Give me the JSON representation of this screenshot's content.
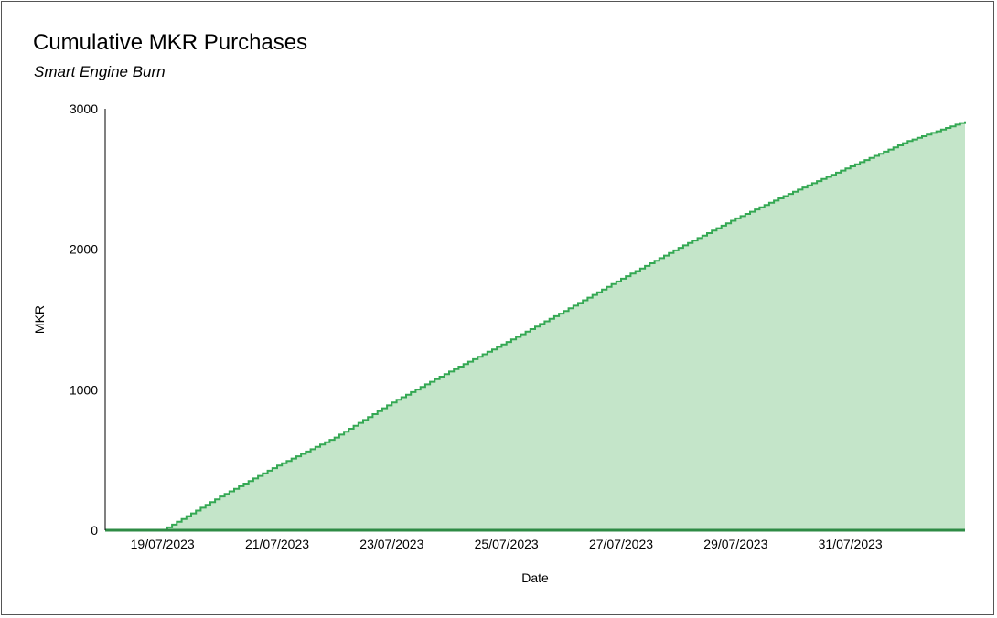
{
  "chart_data": {
    "type": "area",
    "title": "Cumulative MKR Purchases",
    "subtitle": "Smart Engine Burn",
    "xlabel": "Date",
    "ylabel": "MKR",
    "ylim": [
      0,
      3000
    ],
    "yticks": [
      0,
      1000,
      2000,
      3000
    ],
    "x_start": "18/07/2023",
    "x_end": "02/08/2023",
    "xticks": [
      "19/07/2023",
      "21/07/2023",
      "23/07/2023",
      "25/07/2023",
      "27/07/2023",
      "29/07/2023",
      "31/07/2023"
    ],
    "grid": false,
    "series": [
      {
        "x": [
          "18/07/2023",
          "19/07/2023",
          "20/07/2023",
          "21/07/2023",
          "22/07/2023",
          "23/07/2023",
          "24/07/2023",
          "25/07/2023",
          "26/07/2023",
          "27/07/2023",
          "28/07/2023",
          "29/07/2023",
          "30/07/2023",
          "31/07/2023",
          "01/08/2023",
          "02/08/2023"
        ],
        "values": [
          0,
          0,
          240,
          460,
          660,
          910,
          1130,
          1340,
          1560,
          1790,
          2010,
          2220,
          2410,
          2590,
          2770,
          2910
        ]
      }
    ],
    "colors": {
      "line": "#34a853",
      "fill": "#c4e5c9",
      "axis": "#000000"
    }
  }
}
